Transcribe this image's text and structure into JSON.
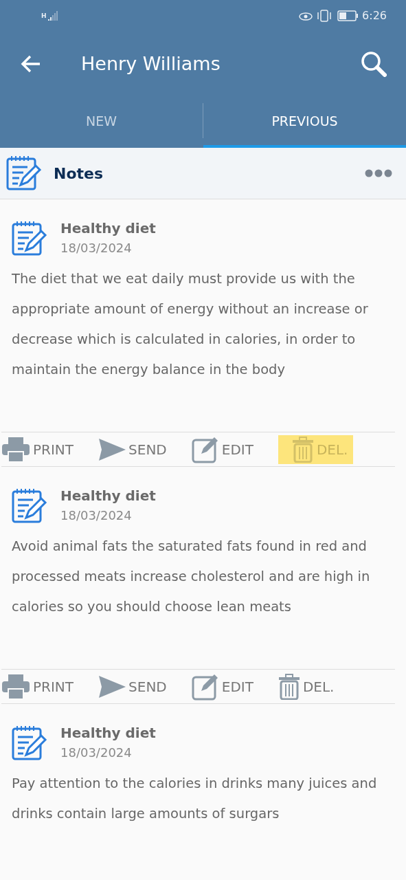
{
  "status_bar": {
    "network": "H",
    "time": "6:26"
  },
  "app_bar": {
    "title": "Henry Williams"
  },
  "tabs": [
    {
      "label": "NEW",
      "selected": false
    },
    {
      "label": "PREVIOUS",
      "selected": true
    }
  ],
  "section": {
    "title": "Notes"
  },
  "notes": [
    {
      "title": "Healthy diet",
      "date": "18/03/2024",
      "body": "The diet that we eat daily must provide us with the appropriate amount of energy without an increase or decrease which is calculated in calories, in order to maintain the energy balance in the body",
      "actions": [
        {
          "kind": "print",
          "label": "PRINT",
          "highlighted": false
        },
        {
          "kind": "send",
          "label": "SEND",
          "highlighted": false
        },
        {
          "kind": "edit",
          "label": "EDIT",
          "highlighted": false
        },
        {
          "kind": "delete",
          "label": "DEL.",
          "highlighted": true
        }
      ]
    },
    {
      "title": "Healthy diet",
      "date": "18/03/2024",
      "body": "Avoid animal fats the saturated fats found in red and processed meats increase cholesterol and are high in calories so you should choose lean meats",
      "actions": [
        {
          "kind": "print",
          "label": "PRINT",
          "highlighted": false
        },
        {
          "kind": "send",
          "label": "SEND",
          "highlighted": false
        },
        {
          "kind": "edit",
          "label": "EDIT",
          "highlighted": false
        },
        {
          "kind": "delete",
          "label": "DEL.",
          "highlighted": false
        }
      ]
    },
    {
      "title": "Healthy diet",
      "date": "18/03/2024",
      "body": "Pay attention to the calories in drinks many juices and drinks contain large amounts of surgars"
    }
  ]
}
